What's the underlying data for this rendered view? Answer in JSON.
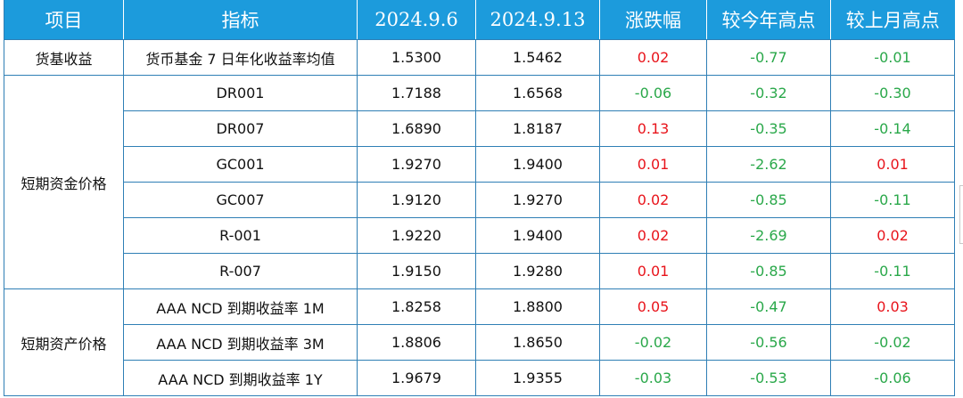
{
  "table": {
    "headers": [
      "项目",
      "指标",
      "2024.9.6",
      "2024.9.13",
      "涨跌幅",
      "较今年高点",
      "较上月高点"
    ],
    "groups": [
      {
        "name": "货基收益",
        "rows": [
          {
            "indicator": "货币基金 7 日年化收益率均值",
            "v1": "1.5300",
            "v2": "1.5462",
            "chg": "0.02",
            "vs_year_high": "-0.77",
            "vs_month_high": "-0.01"
          }
        ]
      },
      {
        "name": "短期资金价格",
        "rows": [
          {
            "indicator": "DR001",
            "v1": "1.7188",
            "v2": "1.6568",
            "chg": "-0.06",
            "vs_year_high": "-0.32",
            "vs_month_high": "-0.30"
          },
          {
            "indicator": "DR007",
            "v1": "1.6890",
            "v2": "1.8187",
            "chg": "0.13",
            "vs_year_high": "-0.35",
            "vs_month_high": "-0.14"
          },
          {
            "indicator": "GC001",
            "v1": "1.9270",
            "v2": "1.9400",
            "chg": "0.01",
            "vs_year_high": "-2.62",
            "vs_month_high": "0.01"
          },
          {
            "indicator": "GC007",
            "v1": "1.9120",
            "v2": "1.9270",
            "chg": "0.02",
            "vs_year_high": "-0.85",
            "vs_month_high": "-0.11"
          },
          {
            "indicator": "R-001",
            "v1": "1.9220",
            "v2": "1.9400",
            "chg": "0.02",
            "vs_year_high": "-2.69",
            "vs_month_high": "0.02"
          },
          {
            "indicator": "R-007",
            "v1": "1.9150",
            "v2": "1.9280",
            "chg": "0.01",
            "vs_year_high": "-0.85",
            "vs_month_high": "-0.11"
          }
        ]
      },
      {
        "name": "短期资产价格",
        "rows": [
          {
            "indicator": "AAA NCD 到期收益率 1M",
            "v1": "1.8258",
            "v2": "1.8800",
            "chg": "0.05",
            "vs_year_high": "-0.47",
            "vs_month_high": "0.03"
          },
          {
            "indicator": "AAA NCD 到期收益率 3M",
            "v1": "1.8806",
            "v2": "1.8650",
            "chg": "-0.02",
            "vs_year_high": "-0.56",
            "vs_month_high": "-0.02"
          },
          {
            "indicator": "AAA NCD 到期收益率 1Y",
            "v1": "1.9679",
            "v2": "1.9355",
            "chg": "-0.03",
            "vs_year_high": "-0.53",
            "vs_month_high": "-0.06"
          }
        ]
      }
    ]
  },
  "colors": {
    "header_bg": "#1c9bdc",
    "border": "#2f7fb5",
    "positive": "#e8141b",
    "negative": "#2aa84a"
  }
}
